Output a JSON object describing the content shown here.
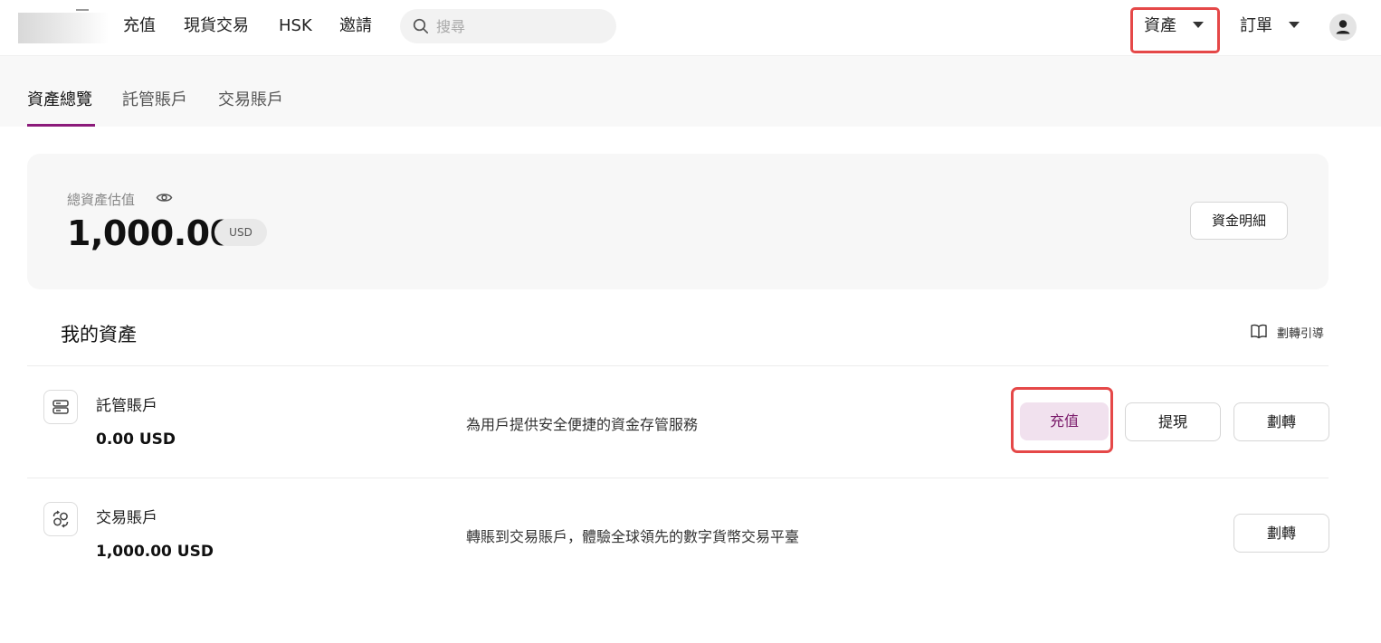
{
  "nav": {
    "deposit": "充值",
    "spot_trading": "現貨交易",
    "hsk": "HSK",
    "invite": "邀請",
    "search_placeholder": "搜尋",
    "assets": "資產",
    "orders": "訂單"
  },
  "tabs": [
    {
      "label": "資產總覽",
      "active": true
    },
    {
      "label": "託管賬戶",
      "active": false
    },
    {
      "label": "交易賬戶",
      "active": false
    }
  ],
  "summary": {
    "label": "總資產估值",
    "amount": "1,000.00",
    "currency": "USD",
    "details_button": "資金明細"
  },
  "my_assets": {
    "title": "我的資產",
    "guide_link": "劃轉引導",
    "accounts": [
      {
        "name": "託管賬戶",
        "balance": "0.00 USD",
        "description": "為用戶提供安全便捷的資金存管服務",
        "actions": {
          "deposit": "充值",
          "withdraw": "提現",
          "transfer": "劃轉"
        }
      },
      {
        "name": "交易賬戶",
        "balance": "1,000.00 USD",
        "description": "轉賬到交易賬戶，體驗全球領先的數字貨幣交易平臺",
        "actions": {
          "transfer": "劃轉"
        }
      }
    ]
  },
  "colors": {
    "accent": "#8b1a7a",
    "deposit_bg": "#f1e1ee",
    "deposit_text": "#7a1a6a",
    "highlight_box": "#e54848"
  }
}
